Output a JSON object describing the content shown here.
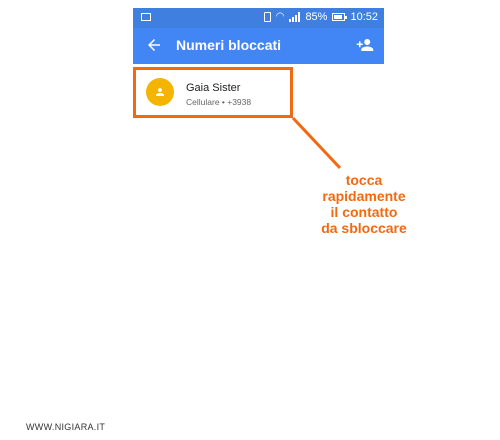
{
  "status_bar": {
    "battery": "85%",
    "time": "10:52",
    "icons": [
      "image-icon",
      "vibrate-icon",
      "wifi-icon",
      "signal-icon",
      "battery-icon"
    ]
  },
  "app_bar": {
    "title": "Numeri bloccati",
    "back_icon": "arrow-back-icon",
    "action_icon": "add-person-icon",
    "color": "#4285f4"
  },
  "contacts": [
    {
      "name": "Gaia Sister",
      "detail": "Cellulare • +3938",
      "avatar_color": "#f5b400"
    }
  ],
  "callout": {
    "lines": [
      "tocca",
      "rapidamente",
      "il contatto",
      "da sbloccare"
    ],
    "color": "#f26a10"
  },
  "footer": {
    "text": "WWW.NIGIARA.IT"
  }
}
